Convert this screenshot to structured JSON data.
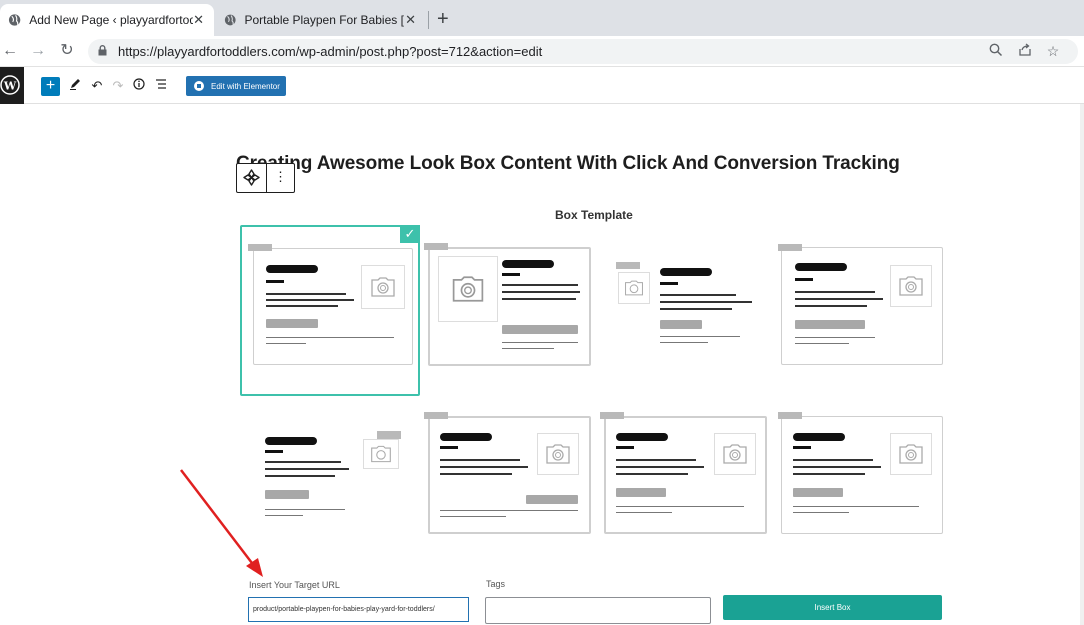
{
  "browser": {
    "tabs": [
      {
        "title": "Add New Page ‹ playyardfortodd",
        "active": true
      },
      {
        "title": "Portable Playpen For Babies [ Pla",
        "active": false
      }
    ],
    "url": "https://playyardfortoddlers.com/wp-admin/post.php?post=712&action=edit"
  },
  "wp_toolbar": {
    "elementor_label": "Edit with Elementor",
    "colors": {
      "primary": "#2271b1",
      "add": "#007cba"
    }
  },
  "content": {
    "title": "Creating Awesome Look Box Content With Click And Conversion Tracking",
    "section_label": "Box Template",
    "templates": [
      {
        "name": "template-1",
        "selected": true
      },
      {
        "name": "template-2",
        "selected": false
      },
      {
        "name": "template-3",
        "selected": false
      },
      {
        "name": "template-4",
        "selected": false
      },
      {
        "name": "template-5",
        "selected": false
      },
      {
        "name": "template-6",
        "selected": false
      },
      {
        "name": "template-7",
        "selected": false
      },
      {
        "name": "template-8",
        "selected": false
      }
    ],
    "accent_color": "#3dc1ab"
  },
  "form": {
    "url_label": "Insert Your Target URL",
    "url_value": "product/portable-playpen-for-babies-play-yard-for-toddlers/",
    "tags_label": "Tags",
    "tags_value": "",
    "insert_label": "Insert Box",
    "insert_color": "#1aa294"
  },
  "annotation": {
    "arrow_color": "#e02020"
  }
}
